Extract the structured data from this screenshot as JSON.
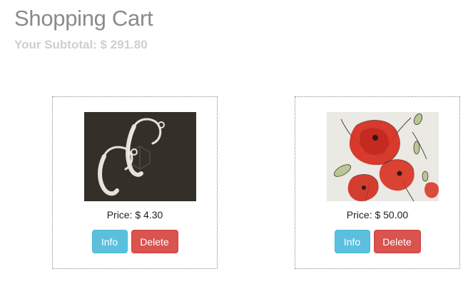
{
  "header": {
    "title": "Shopping Cart",
    "subtotal": "Your Subtotal: $ 291.80"
  },
  "items": [
    {
      "image": "earrings-photo",
      "price": "Price: $ 4.30",
      "info_label": "Info",
      "delete_label": "Delete"
    },
    {
      "image": "poppies-painting",
      "price": "Price: $ 50.00",
      "info_label": "Info",
      "delete_label": "Delete"
    }
  ],
  "colors": {
    "info": "#5bc0de",
    "delete": "#d9534f",
    "title": "#8a8a8a",
    "subtotal": "#cfcfcf"
  }
}
